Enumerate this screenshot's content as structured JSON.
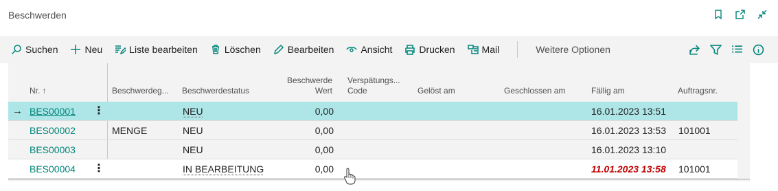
{
  "page": {
    "title": "Beschwerden",
    "title_icons": [
      "bookmark-icon",
      "open-new-window-icon",
      "collapse-icon"
    ]
  },
  "actions": {
    "search": "Suchen",
    "new": "Neu",
    "edit_list": "Liste bearbeiten",
    "delete": "Löschen",
    "edit": "Bearbeiten",
    "view": "Ansicht",
    "print": "Drucken",
    "mail": "Mail",
    "more_options": "Weitere Optionen"
  },
  "right_icons": [
    "share-icon",
    "filter-icon",
    "list-view-icon",
    "info-icon"
  ],
  "columns": {
    "nr": "Nr. ↑",
    "beschwerdegrund": "Beschwerdeg...",
    "status": "Beschwerdestatus",
    "wert_line1": "Beschwerde",
    "wert_line2": "Wert",
    "versp_line1": "Verspätungs...",
    "versp_line2": "Code",
    "geloest": "Gelöst am",
    "geschlossen": "Geschlossen am",
    "faellig": "Fällig am",
    "auftrag": "Auftragsnr."
  },
  "rows": [
    {
      "nr": "BES00001",
      "grund": "",
      "status": "NEU",
      "wert": "0,00",
      "faellig": "16.01.2023 13:51",
      "auftrag": ""
    },
    {
      "nr": "BES00002",
      "grund": "MENGE",
      "status": "NEU",
      "wert": "0,00",
      "faellig": "16.01.2023 13:53",
      "auftrag": "101001"
    },
    {
      "nr": "BES00003",
      "grund": "",
      "status": "NEU",
      "wert": "0,00",
      "faellig": "16.01.2023 13:10",
      "auftrag": ""
    },
    {
      "nr": "BES00004",
      "grund": "",
      "status": "IN BEARBEITUNG",
      "wert": "0,00",
      "faellig": "11.01.2023 13:58",
      "auftrag": "101001"
    }
  ],
  "colors": {
    "accent": "#00857a",
    "selected_row": "#aee6e8",
    "overdue": "#c00000"
  }
}
